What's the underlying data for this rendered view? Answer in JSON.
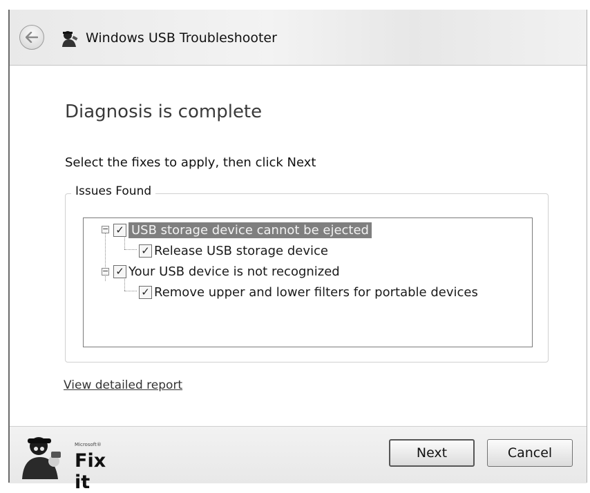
{
  "window": {
    "title": "Windows USB Troubleshooter"
  },
  "content": {
    "heading": "Diagnosis is complete",
    "instruction": "Select the fixes to apply, then click Next",
    "group_title": "Issues Found",
    "issues": [
      {
        "label": "USB storage device cannot be ejected",
        "checked": true,
        "selected": true,
        "fix": {
          "label": "Release USB storage device",
          "checked": true
        }
      },
      {
        "label": "Your USB device is not recognized",
        "checked": true,
        "selected": false,
        "fix": {
          "label": "Remove upper and lower filters for portable devices",
          "checked": true
        }
      }
    ],
    "report_link": "View detailed report"
  },
  "footer": {
    "brand_small": "Microsoft®",
    "brand_main": "Fix it",
    "next_label": "Next",
    "cancel_label": "Cancel"
  },
  "icons": {
    "back": "back-arrow-icon",
    "app": "fixit-guy-icon",
    "checkbox": "checkmark-icon",
    "expander": "collapse-minus-icon"
  }
}
